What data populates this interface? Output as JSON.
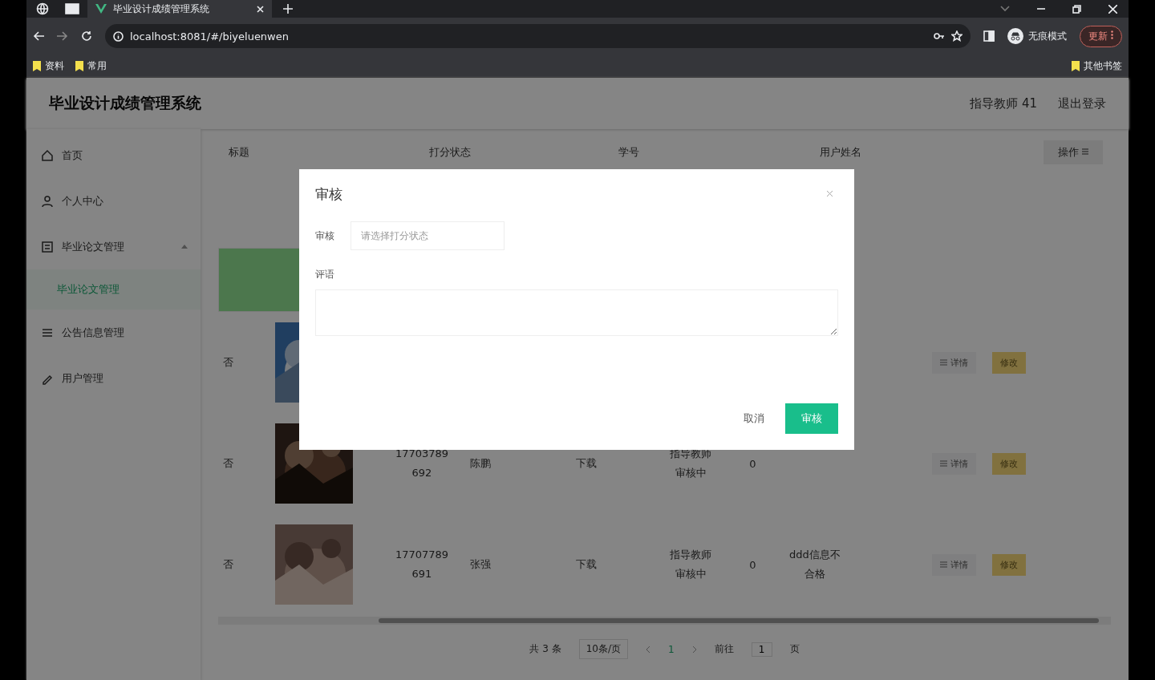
{
  "browser": {
    "tab": {
      "title": "毕业设计成绩管理系统",
      "selected": true
    },
    "url": "localhost:8081/#/biyeluenwen",
    "profile": "无痕模式",
    "update_button": "更新",
    "bookmarks": [
      "资料",
      "常用"
    ],
    "other_bookmarks": "其他书签"
  },
  "app": {
    "title": "毕业设计成绩管理系统",
    "user": "指导教师 41",
    "logout": "退出登录"
  },
  "sidebar": {
    "items": [
      {
        "label": "首页",
        "selected": false
      },
      {
        "label": "个人中心",
        "selected": false
      },
      {
        "label": "毕业论文管理",
        "selected": false,
        "expanded": true,
        "children": [
          {
            "label": "毕业论文管理",
            "selected": true
          }
        ]
      },
      {
        "label": "公告信息管理",
        "selected": false
      },
      {
        "label": "用户管理",
        "selected": false
      }
    ]
  },
  "table": {
    "columns": [
      "标题",
      "打分状态",
      "学号",
      "用户姓名",
      "操作"
    ],
    "rows": [
      {
        "selected": true,
        "actions": []
      },
      {
        "selected": false,
        "column_1": "否",
        "actions": [
          "详情",
          "修改"
        ]
      },
      {
        "selected": false,
        "column_1": "否",
        "phone": "17703789692",
        "name": "陈鹏",
        "file": "下载",
        "status": "指导教师审核中",
        "score": "0",
        "actions": [
          "详情",
          "修改"
        ]
      },
      {
        "selected": false,
        "column_1": "否",
        "phone": "17707789691",
        "name": "张强",
        "file": "下载",
        "status": "指导教师审核中",
        "score": "0",
        "comment": "ddd信息不合格",
        "actions": [
          "详情",
          "修改"
        ]
      }
    ]
  },
  "pagination": {
    "total": "共 3 条",
    "page_size": "10条/页",
    "pages": [
      {
        "label": "1",
        "selected": true
      }
    ],
    "goto": "前往",
    "goto_value": "1",
    "page_suffix": "页"
  },
  "dialog": {
    "title": "审核",
    "fields": [
      {
        "kind": "select",
        "label": "审核",
        "placeholder": "请选择打分状态"
      },
      {
        "kind": "textarea",
        "label": "评语"
      }
    ],
    "buttons": [
      {
        "label": "取消",
        "primary": false
      },
      {
        "label": "审核",
        "primary": true
      }
    ]
  }
}
